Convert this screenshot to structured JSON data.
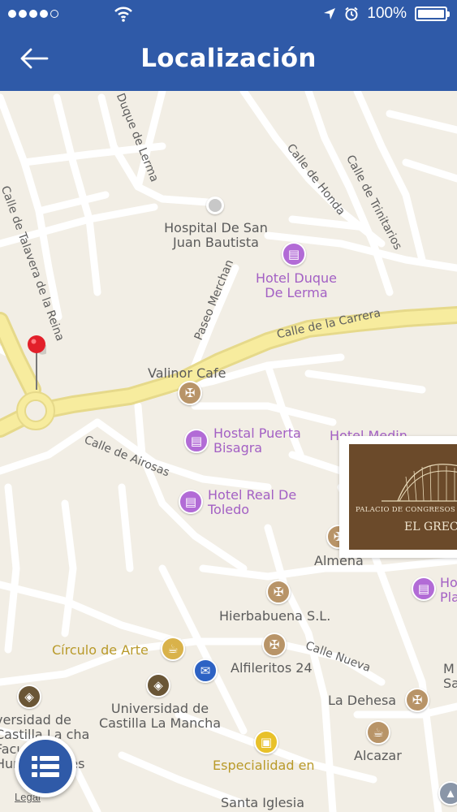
{
  "status_bar": {
    "battery": "100%"
  },
  "header": {
    "title": "Localización"
  },
  "map": {
    "streets": [
      "Calle de Talavera de la Reina",
      "Duque de Lerma",
      "Calle de Honda",
      "Calle de Trinitarios",
      "Paseo Merchan",
      "Calle de la Carrera",
      "Calle de Airosas",
      "Calle Nueva"
    ],
    "places": {
      "hospital": "Hospital De San Juan Bautista",
      "hotel_duque": "Hotel Duque De Lerma",
      "valinor": "Valinor Cafe",
      "hostal_puerta": "Hostal Puerta Bisagra",
      "hotel_real": "Hotel Real De Toledo",
      "hotel_medina": "Hotel Medin",
      "almena": "Almena",
      "hotel_plaza": "Ho Pla",
      "hierbabuena": "Hierbabuena S.L.",
      "circulo": "Círculo de Arte",
      "alfileritos": "Alfileritos 24",
      "universidad": "Universidad de Castilla La Mancha",
      "universidad_left": "versidad de Castilla La cha Facultad Humanidades",
      "la_dehesa": "La Dehesa",
      "alcazar": "Alcazar",
      "especialidad": "Especialidad en",
      "santa_iglesia": "Santa Iglesia",
      "right_edge": "M Sa",
      "legal": "Legal"
    }
  },
  "ad": {
    "line1": "PALACIO DE CONGRESOS D",
    "line2": "EL GRECO"
  },
  "colors": {
    "header": "#2f5aa8",
    "hotel": "#b26bd6",
    "restaurant": "#b89468",
    "main_road": "#f7ec9e"
  },
  "icons": {
    "back": "arrow-left-icon",
    "fab": "list-icon",
    "pin": "map-pin-icon"
  }
}
